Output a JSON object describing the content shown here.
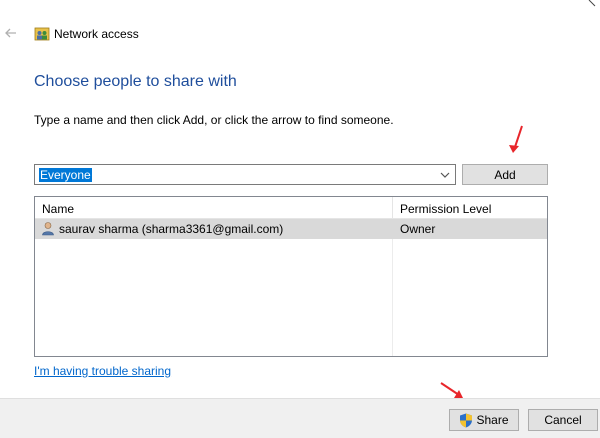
{
  "window": {
    "title": "Network access"
  },
  "heading": "Choose people to share with",
  "instruction": "Type a name and then click Add, or click the arrow to find someone.",
  "combo": {
    "value": "Everyone"
  },
  "add_label": "Add",
  "list": {
    "columns": [
      "Name",
      "Permission Level"
    ],
    "rows": [
      {
        "name": "saurav sharma (sharma3361@gmail.com)",
        "permission": "Owner"
      }
    ]
  },
  "trouble_link": "I'm having trouble sharing",
  "footer": {
    "share_label": "Share",
    "cancel_label": "Cancel"
  },
  "colors": {
    "accent": "#1f4e9c",
    "selection": "#0078d7",
    "annotation_arrow": "#e8262b"
  },
  "icons": [
    "back-arrow-icon",
    "network-users-icon",
    "chevron-down-icon",
    "user-icon",
    "uac-shield-icon",
    "close-icon"
  ]
}
